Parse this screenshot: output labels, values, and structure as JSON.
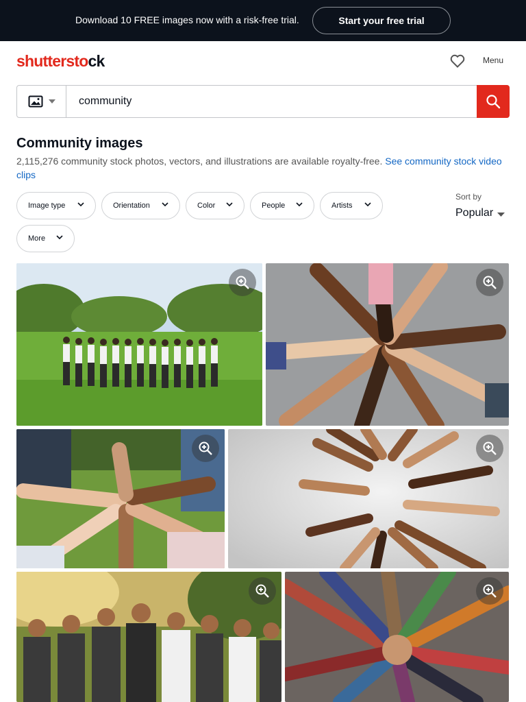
{
  "promo": {
    "text": "Download 10 FREE images now with a risk-free trial.",
    "button": "Start your free trial"
  },
  "header": {
    "logo_red": "shutterst",
    "logo_mid": "o",
    "logo_end": "ck",
    "favorites_icon": "heart-icon",
    "menu_label": "Menu"
  },
  "search": {
    "type_icon": "image-icon",
    "value": "community",
    "button_icon": "search-icon"
  },
  "results": {
    "title": "Community images",
    "description": "2,115,276 community stock photos, vectors, and illustrations are available royalty-free.",
    "video_link": "See community stock video clips"
  },
  "filters": [
    "Image type",
    "Orientation",
    "Color",
    "People",
    "Artists",
    "More"
  ],
  "sort": {
    "label": "Sort by",
    "value": "Popular"
  },
  "colors": {
    "brand_red": "#e2291d",
    "dark": "#0c121c",
    "link": "#1367c4"
  }
}
